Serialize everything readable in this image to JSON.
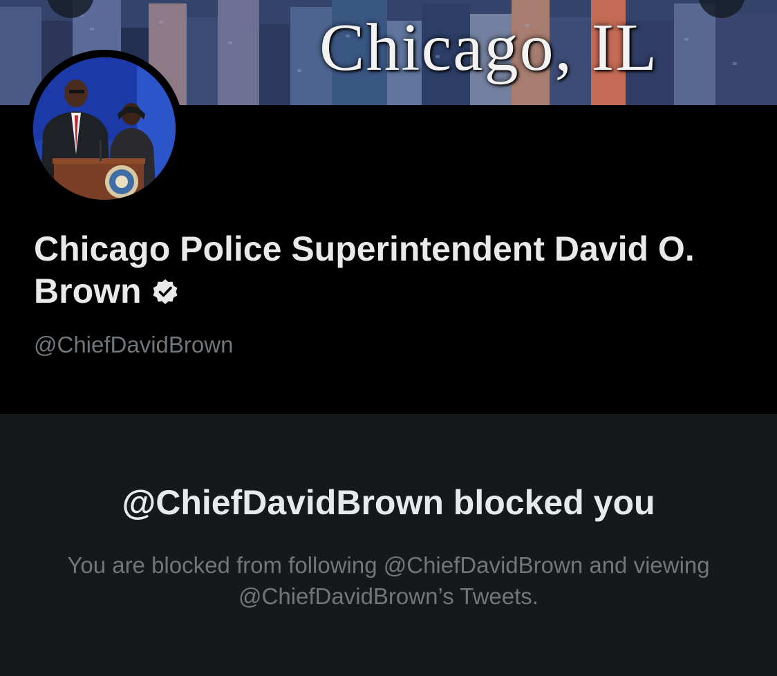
{
  "banner": {
    "text": "Chicago, IL"
  },
  "profile": {
    "name": "Chicago Police Superintendent David O. Brown",
    "handle": "@ChiefDavidBrown",
    "verified": true
  },
  "blocked": {
    "title": "@ChiefDavidBrown blocked you",
    "description": "You are blocked from following @ChiefDavidBrown and viewing @ChiefDavidBrown’s Tweets."
  },
  "colors": {
    "background": "#000000",
    "panel": "#16181c",
    "primary_text": "#e7e9ea",
    "secondary_text": "#71767b"
  },
  "icons": {
    "verified": "verified-badge-icon"
  }
}
